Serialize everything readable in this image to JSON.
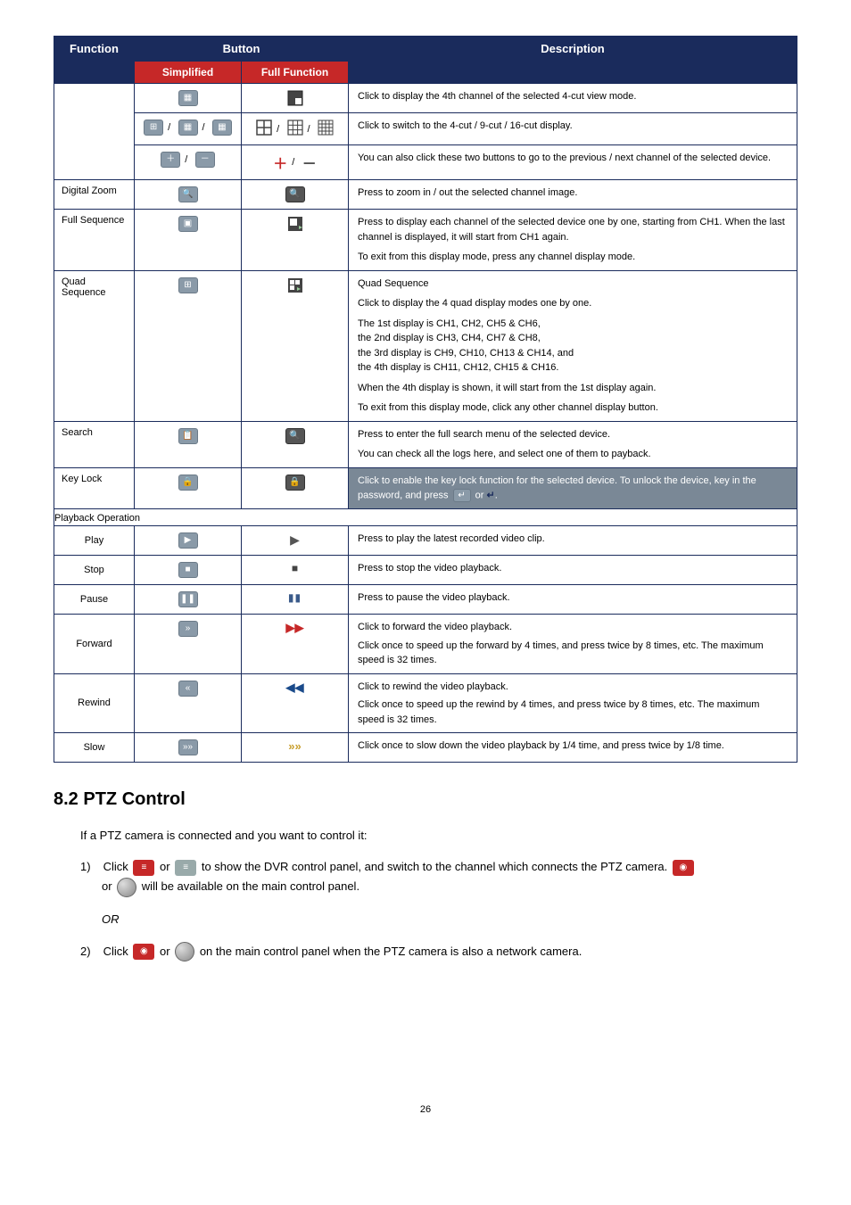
{
  "table": {
    "header": {
      "function": "Function",
      "button": "Button",
      "description": "Description",
      "simplified": "Simplified",
      "full_function": "Full Function"
    },
    "rows": {
      "ch4": {
        "desc": "Click to display the 4th channel of the selected 4-cut view mode."
      },
      "cut": {
        "desc": "Click to switch to the 4-cut / 9-cut / 16-cut display."
      },
      "prevnext": {
        "desc": "You can also click these two buttons to go to the previous / next channel of the selected device."
      },
      "zoom": {
        "func": "Digital Zoom",
        "desc": "Press to zoom in / out the selected channel image."
      },
      "fullseq": {
        "func": "Full Sequence",
        "desc1": "Press to display each channel of the selected device one by one, starting from CH1. When the last channel is displayed, it will start from CH1 again.",
        "desc2": "To exit from this display mode, press any channel display mode."
      },
      "quadseq": {
        "func": "Quad Sequence",
        "l1": "Quad Sequence",
        "l2": "Click to display the 4 quad display modes one by one.",
        "l3": "The 1st display is CH1, CH2, CH5 & CH6,",
        "l4": "the 2nd display is CH3, CH4, CH7 & CH8,",
        "l5": "the 3rd display is CH9, CH10, CH13 & CH14, and",
        "l6": "the 4th display is CH11, CH12, CH15 & CH16.",
        "l7": "When the 4th display is shown, it will start from the 1st display again.",
        "l8": "To exit from this display mode, click any other channel display button."
      },
      "search": {
        "func": "Search",
        "l1": "Press to enter the full search menu of the selected device.",
        "l2": "You can check all the logs here, and select one of them to payback."
      },
      "keylock": {
        "func": "Key Lock",
        "l1": "Click to enable the key lock function for the selected device. To unlock the device, key in the password, and press ",
        "l2": " or ",
        "l3": "."
      }
    },
    "playback_section": "Playback Operation",
    "playback": {
      "play": {
        "func": "Play",
        "desc": "Press to play the latest recorded video clip."
      },
      "stop": {
        "func": "Stop",
        "desc": "Press to stop the video playback."
      },
      "pause": {
        "func": "Pause",
        "desc": "Press to pause the video playback."
      },
      "forward": {
        "func": "Forward",
        "l1": "Click to forward the video playback.",
        "l2": "Click once to speed up the forward by 4 times, and press twice by 8 times, etc. The maximum speed is 32 times."
      },
      "rewind": {
        "func": "Rewind",
        "l1": "Click to rewind the video playback.",
        "l2": "Click once to speed up the rewind by 4 times, and press twice by 8 times, etc. The maximum speed is 32 times."
      },
      "slow": {
        "func": "Slow",
        "desc": "Click once to slow down the video playback by 1/4 time, and press twice by 1/8 time."
      }
    }
  },
  "section": {
    "heading": "8.2 PTZ Control",
    "intro": "If a PTZ camera is connected and you want to control it:",
    "step1a": "Click ",
    "step1b": " or ",
    "step1c": " to show the DVR control panel, and switch to the channel which connects the PTZ camera. ",
    "step1d": " or ",
    "step1e": " will be available on the main control panel.",
    "or": "OR",
    "step2a": "Click ",
    "step2b": " or ",
    "step2c": " on the main control panel when the PTZ camera is also a network camera."
  },
  "page_number": "26"
}
